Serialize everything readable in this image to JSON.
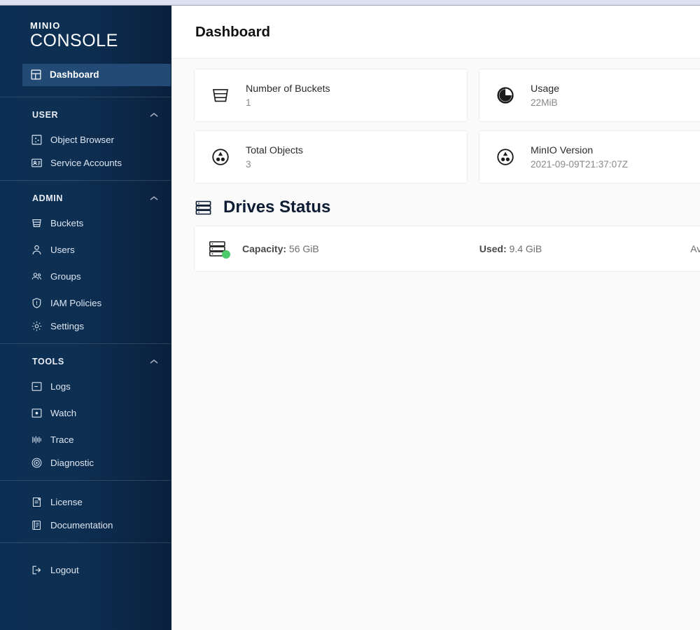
{
  "colors": {
    "sidebar_start": "#0b2f53",
    "sidebar_end": "#0a203d",
    "active_item": "#234a74",
    "page_bg": "#fafafa",
    "card_bg": "#ffffff",
    "status_ok": "#4ccb6a",
    "title": "#0d1b33",
    "top_strip": "#dde2f2"
  },
  "sidebar": {
    "logo_top": "MINIO",
    "logo_bottom": "CONSOLE",
    "active_item": {
      "label": "Dashboard",
      "icon": "dashboard-icon"
    },
    "groups": [
      {
        "title": "USER",
        "caret": "collapse-caret-icon",
        "items": [
          {
            "label": "Object Browser",
            "icon": "object-browser-icon"
          },
          {
            "label": "Service Accounts",
            "icon": "service-accounts-icon"
          }
        ]
      },
      {
        "title": "ADMIN",
        "caret": "collapse-caret-icon",
        "items": [
          {
            "label": "Buckets",
            "icon": "bucket-icon"
          },
          {
            "label": "Users",
            "icon": "user-icon"
          },
          {
            "label": "Groups",
            "icon": "groups-icon"
          },
          {
            "label": "IAM Policies",
            "icon": "shield-icon"
          },
          {
            "label": "Settings",
            "icon": "gear-icon"
          }
        ]
      },
      {
        "title": "TOOLS",
        "caret": "collapse-caret-icon",
        "items": [
          {
            "label": "Logs",
            "icon": "logs-icon"
          },
          {
            "label": "Watch",
            "icon": "watch-icon"
          },
          {
            "label": "Trace",
            "icon": "trace-icon"
          },
          {
            "label": "Diagnostic",
            "icon": "diagnostic-icon"
          }
        ]
      }
    ],
    "footer_items": [
      {
        "label": "License",
        "icon": "license-icon"
      },
      {
        "label": "Documentation",
        "icon": "documentation-icon"
      }
    ],
    "logout": {
      "label": "Logout",
      "icon": "logout-icon"
    }
  },
  "header": {
    "title": "Dashboard"
  },
  "cards": [
    {
      "label": "Number of Buckets",
      "value": "1",
      "icon": "bucket-icon"
    },
    {
      "label": "Usage",
      "value": "22MiB",
      "icon": "pie-usage-icon"
    },
    {
      "label": "Total Objects",
      "value": "3",
      "icon": "objects-icon"
    },
    {
      "label": "MinIO Version",
      "value": "2021-09-09T21:37:07Z",
      "icon": "minio-version-icon"
    }
  ],
  "drives_section": {
    "title": "Drives Status",
    "icon": "drive-stack-icon",
    "drive": {
      "status": "online",
      "capacity_label": "Capacity:",
      "capacity_value": "56 GiB",
      "used_label": "Used:",
      "used_value": "9.4 GiB",
      "available_label": "Available"
    }
  }
}
